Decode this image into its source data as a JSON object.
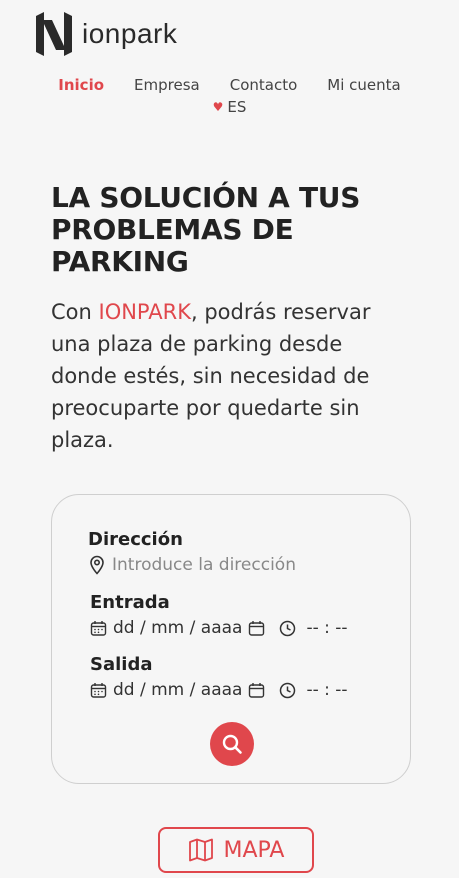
{
  "brand": {
    "name": "ionpark",
    "accent_color": "#e0474c"
  },
  "nav": {
    "items": [
      {
        "label": "Inicio",
        "active": true
      },
      {
        "label": "Empresa",
        "active": false
      },
      {
        "label": "Contacto",
        "active": false
      },
      {
        "label": "Mi cuenta",
        "active": false
      }
    ],
    "language": "ES"
  },
  "hero": {
    "title": "LA SOLUCIÓN A TUS PROBLEMAS DE PARKING",
    "text_before": "Con ",
    "brand_word": "IONPARK",
    "text_after": ", podrás reservar una plaza de parking desde donde estés, sin necesidad de preocuparte por quedarte sin plaza."
  },
  "search": {
    "address_label": "Dirección",
    "address_placeholder": "Introduce la dirección",
    "entry_label": "Entrada",
    "exit_label": "Salida",
    "date_placeholder": "dd / mm / aaaa",
    "time_placeholder": "-- : --"
  },
  "map_button": {
    "label": "MAPA"
  }
}
